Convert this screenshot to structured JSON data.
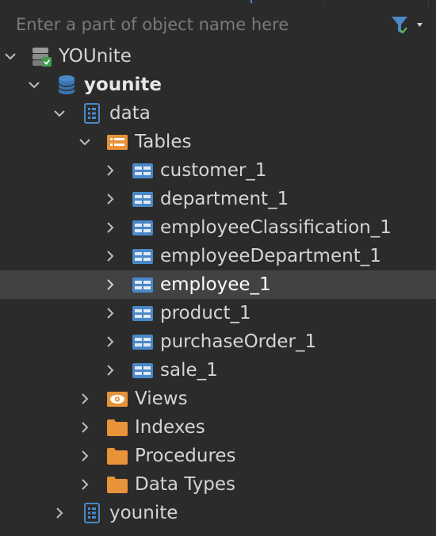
{
  "search": {
    "placeholder": "Enter a part of object name here"
  },
  "colors": {
    "background": "#2b2b2b",
    "selected_row": "#404244",
    "table_icon": "#4a88c7",
    "folder_icon": "#e8923a",
    "text": "#d4d4d4"
  },
  "tree": {
    "connection": {
      "label": "YOUnite",
      "icon": "server-database-icon",
      "expanded": true
    },
    "database": {
      "label": "younite",
      "icon": "database-icon",
      "expanded": true
    },
    "schema": {
      "label": "data",
      "icon": "schema-icon",
      "expanded": true
    },
    "tables_folder": {
      "label": "Tables",
      "icon": "tables-folder-icon",
      "expanded": true
    },
    "tables": [
      {
        "label": "customer_1",
        "icon": "table-icon",
        "selected": false
      },
      {
        "label": "department_1",
        "icon": "table-icon",
        "selected": false
      },
      {
        "label": "employeeClassification_1",
        "icon": "table-icon",
        "selected": false
      },
      {
        "label": "employeeDepartment_1",
        "icon": "table-icon",
        "selected": false
      },
      {
        "label": "employee_1",
        "icon": "table-icon",
        "selected": true
      },
      {
        "label": "product_1",
        "icon": "table-icon",
        "selected": false
      },
      {
        "label": "purchaseOrder_1",
        "icon": "table-icon",
        "selected": false
      },
      {
        "label": "sale_1",
        "icon": "table-icon",
        "selected": false
      }
    ],
    "folders": [
      {
        "label": "Views",
        "icon": "views-folder-icon"
      },
      {
        "label": "Indexes",
        "icon": "folder-icon"
      },
      {
        "label": "Procedures",
        "icon": "folder-icon"
      },
      {
        "label": "Data Types",
        "icon": "folder-icon"
      }
    ],
    "other_schema": {
      "label": "younite",
      "icon": "schema-icon",
      "expanded": false
    }
  }
}
